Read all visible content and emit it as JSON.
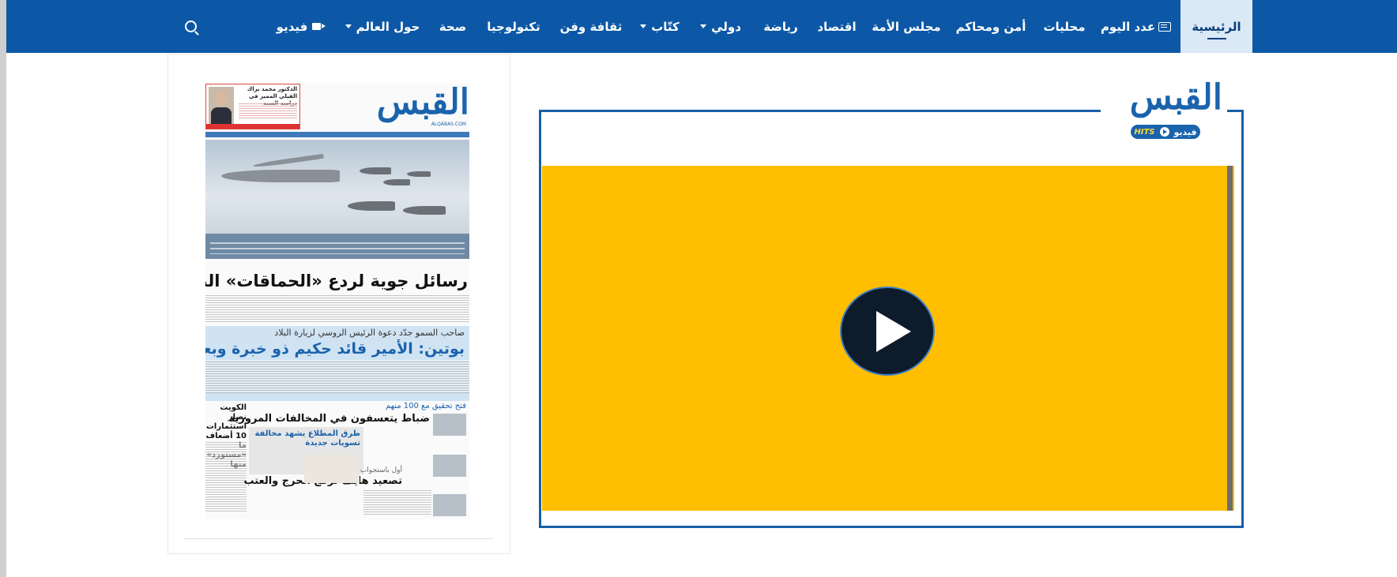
{
  "nav": {
    "items": [
      {
        "label": "الرئيسية"
      },
      {
        "label": "عدد اليوم"
      },
      {
        "label": "محليات"
      },
      {
        "label": "أمن ومحاكم"
      },
      {
        "label": "مجلس الأمة"
      },
      {
        "label": "اقتصاد"
      },
      {
        "label": "رياضة"
      },
      {
        "label": "دولي"
      },
      {
        "label": "كتّاب"
      },
      {
        "label": "ثقافة وفن"
      },
      {
        "label": "تكنولوجيا"
      },
      {
        "label": "صحة"
      },
      {
        "label": "حول العالم"
      },
      {
        "label": "فيديو"
      }
    ],
    "active": "الرئيسية",
    "icons": {
      "today_issue": "newspaper-icon",
      "video": "video-camera-icon",
      "search": "search-icon",
      "dropdown": "chevron-down-icon"
    }
  },
  "newspaper": {
    "logo": "القبس",
    "logo_sub": "ALQABAS.COM",
    "ad_title": "الدكتور محمد براك الفيلي المميز في دراسة السنة",
    "headline_main": "رسائل جوية لردع «الحماقات» البحرية",
    "subheadline": "صاحب السمو جدّد دعوة الرئيس الروسي لزيارة البلاد",
    "headline_second": "بوتين: الأمير قائد حكيم ذو خبرة وبعد نظر",
    "kicker": "فتح تحقيق مع 100 منهم",
    "headline_third": "ضباط يتعسفون في المخالفات المرورية",
    "box_title": "طرق المطلاع يشهد مخالفة تسويات جديدة",
    "side_title": "الكويت نصار استثمارات 10 أضعاف ما «مستورد» منها",
    "kicker2": "أول باستجواب الحجرف",
    "headline_fourth": "تصعيد هايف لرفع الحرج والعتب"
  },
  "video": {
    "logo": "القبس",
    "pill_hits": "HITS",
    "pill_label": "فيديو",
    "player_color": "#ffbf00",
    "icons": {
      "play": "play-icon"
    }
  },
  "colors": {
    "nav_bg": "#0d58a6",
    "brand_blue": "#1a63ad",
    "player_bg": "#ffbf00"
  }
}
